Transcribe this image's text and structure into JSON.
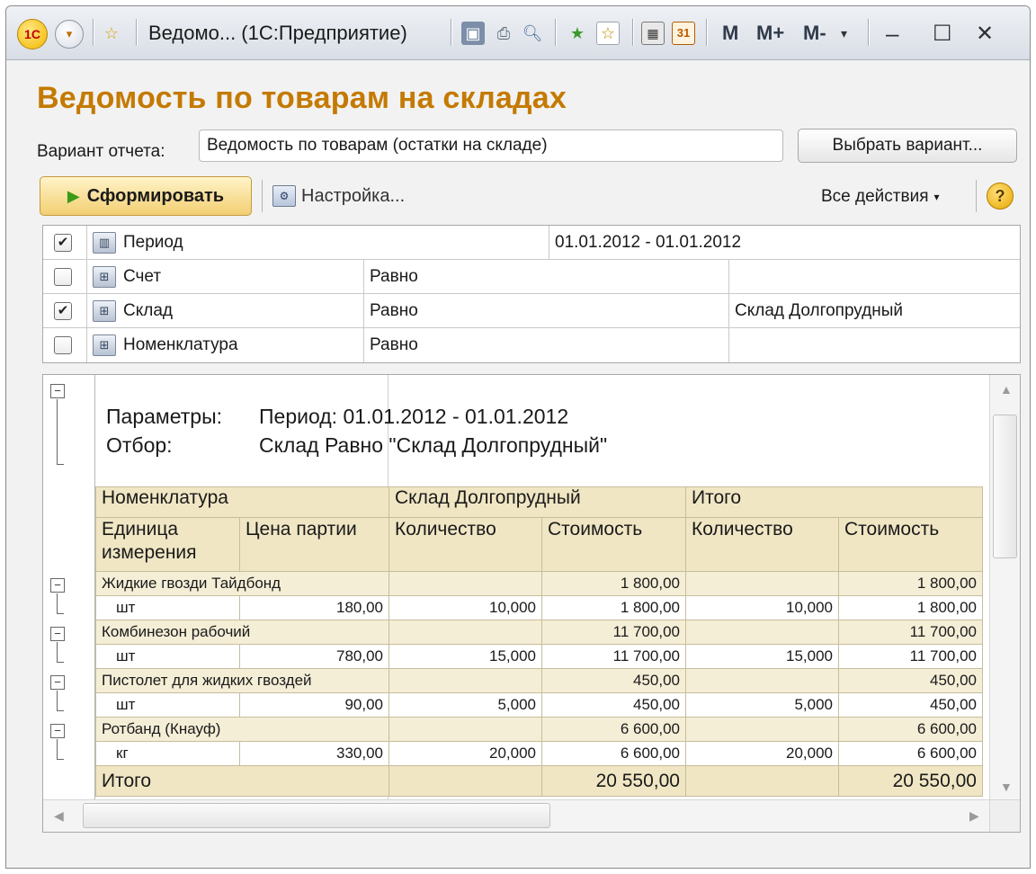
{
  "window": {
    "title": "Ведомо... (1С:Предприятие)",
    "logo": "1С",
    "calc": {
      "m": "M",
      "m_plus": "M+",
      "m_minus": "M-"
    },
    "controls": {
      "minimize": "–",
      "maximize": "☐",
      "close": "✕"
    }
  },
  "report": {
    "title": "Ведомость по товарам на складах",
    "variant_label": "Вариант отчета:",
    "variant_value": "Ведомость по товарам (остатки на складе)",
    "choose_variant": "Выбрать вариант...",
    "generate": "Сформировать",
    "settings": "Настройка...",
    "all_actions": "Все действия",
    "help": "?"
  },
  "filters": [
    {
      "checked": true,
      "name": "Период",
      "condition": "",
      "value": "01.01.2012 - 01.01.2012"
    },
    {
      "checked": false,
      "name": "Счет",
      "condition": "Равно",
      "value": ""
    },
    {
      "checked": true,
      "name": "Склад",
      "condition": "Равно",
      "value": "Склад Долгопрудный"
    },
    {
      "checked": false,
      "name": "Номенклатура",
      "condition": "Равно",
      "value": ""
    }
  ],
  "sheet": {
    "params_label": "Параметры:",
    "params_value": "Период: 01.01.2012 - 01.01.2012",
    "filter_label": "Отбор:",
    "filter_value": "Склад Равно \"Склад Долгопрудный\"",
    "headers": {
      "nomenclature": "Номенклатура",
      "warehouse": "Склад Долгопрудный",
      "total": "Итого",
      "unit": "Единица измерения",
      "price": "Цена партии",
      "qty": "Количество",
      "cost": "Стоимость",
      "qty2": "Количество",
      "cost2": "Стоимость"
    },
    "rows": [
      {
        "name": "Жидкие гвозди Тайдбонд",
        "cost": "1 800,00",
        "total_cost": "1 800,00",
        "unit": "шт",
        "price": "180,00",
        "qty": "10,000",
        "line_cost": "1 800,00",
        "total_qty": "10,000",
        "line_total_cost": "1 800,00"
      },
      {
        "name": "Комбинезон рабочий",
        "cost": "11 700,00",
        "total_cost": "11 700,00",
        "unit": "шт",
        "price": "780,00",
        "qty": "15,000",
        "line_cost": "11 700,00",
        "total_qty": "15,000",
        "line_total_cost": "11 700,00"
      },
      {
        "name": "Пистолет для жидких гвоздей",
        "cost": "450,00",
        "total_cost": "450,00",
        "unit": "шт",
        "price": "90,00",
        "qty": "5,000",
        "line_cost": "450,00",
        "total_qty": "5,000",
        "line_total_cost": "450,00"
      },
      {
        "name": "Ротбанд (Кнауф)",
        "cost": "6 600,00",
        "total_cost": "6 600,00",
        "unit": "кг",
        "price": "330,00",
        "qty": "20,000",
        "line_cost": "6 600,00",
        "total_qty": "20,000",
        "line_total_cost": "6 600,00"
      }
    ],
    "total_label": "Итого",
    "total_cost": "20 550,00",
    "grand_total_cost": "20 550,00"
  }
}
